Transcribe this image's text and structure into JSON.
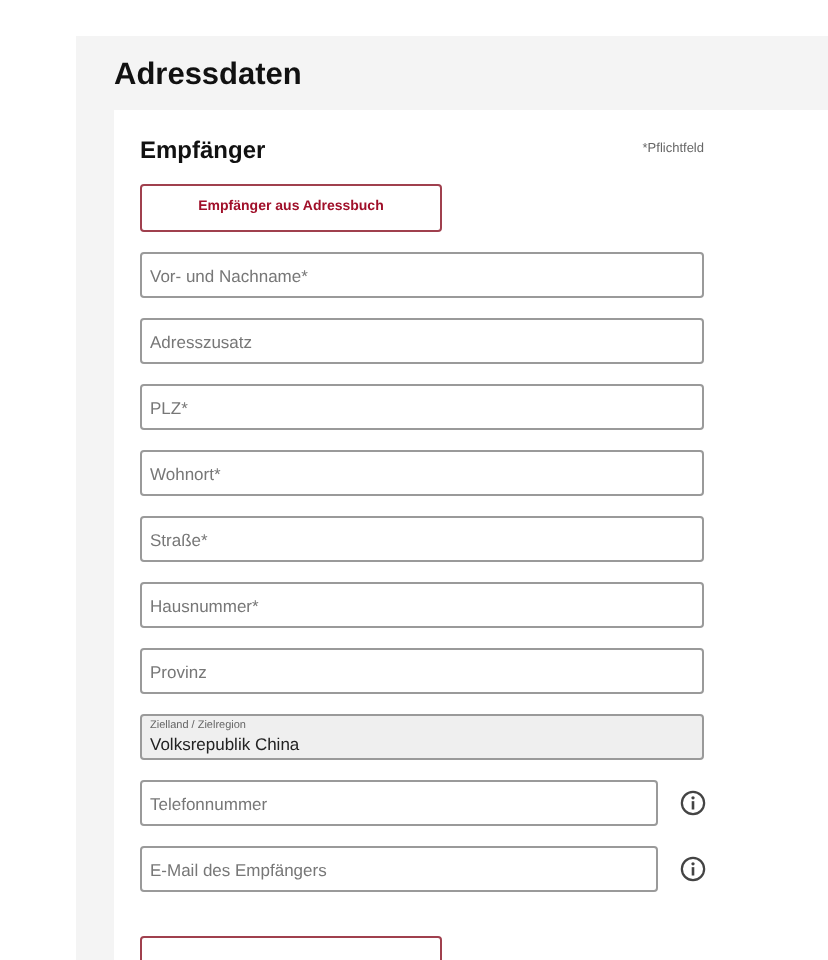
{
  "section_title": "Adressdaten",
  "card": {
    "title": "Empfänger",
    "required_note": "*Pflichtfeld",
    "address_book_button": "Empfänger aus Adressbuch",
    "fields": [
      {
        "kind": "input",
        "placeholder": "Vor- und Nachname*",
        "info": false
      },
      {
        "kind": "input",
        "placeholder": "Adresszusatz",
        "info": false
      },
      {
        "kind": "input",
        "placeholder": "PLZ*",
        "info": false
      },
      {
        "kind": "input",
        "placeholder": "Wohnort*",
        "info": false
      },
      {
        "kind": "input",
        "placeholder": "Straße*",
        "info": false
      },
      {
        "kind": "input",
        "placeholder": "Hausnummer*",
        "info": false
      },
      {
        "kind": "input",
        "placeholder": "Provinz",
        "info": false
      },
      {
        "kind": "readonly",
        "label": "Zielland / Zielregion",
        "value": "Volksrepublik China",
        "info": false
      },
      {
        "kind": "input",
        "placeholder": "Telefonnummer",
        "info": true
      },
      {
        "kind": "input",
        "placeholder": "E-Mail des Empfängers",
        "info": true
      }
    ]
  }
}
